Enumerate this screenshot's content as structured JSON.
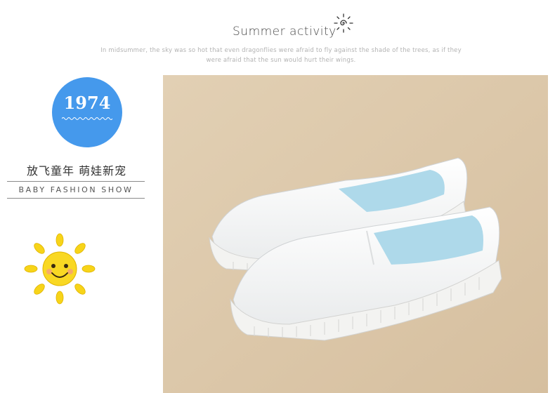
{
  "header": {
    "title": "Summer activity",
    "description_line1": "In midsummer, the sky was so hot that even dragonflies were afraid to fly against the shade of the trees, as if they",
    "description_line2": "were afraid that the sun would hurt their wings."
  },
  "badge": {
    "year": "1974"
  },
  "slogan": {
    "chinese": "放飞童年  萌娃新宠",
    "english": "BABY FASHION SHOW"
  },
  "colors": {
    "badge_blue": "#4599ec",
    "sun_yellow": "#f7d419",
    "photo_background": "#dcc7a9",
    "shoe_white": "#f7f8f8",
    "shoe_lining": "#aed9ea"
  }
}
